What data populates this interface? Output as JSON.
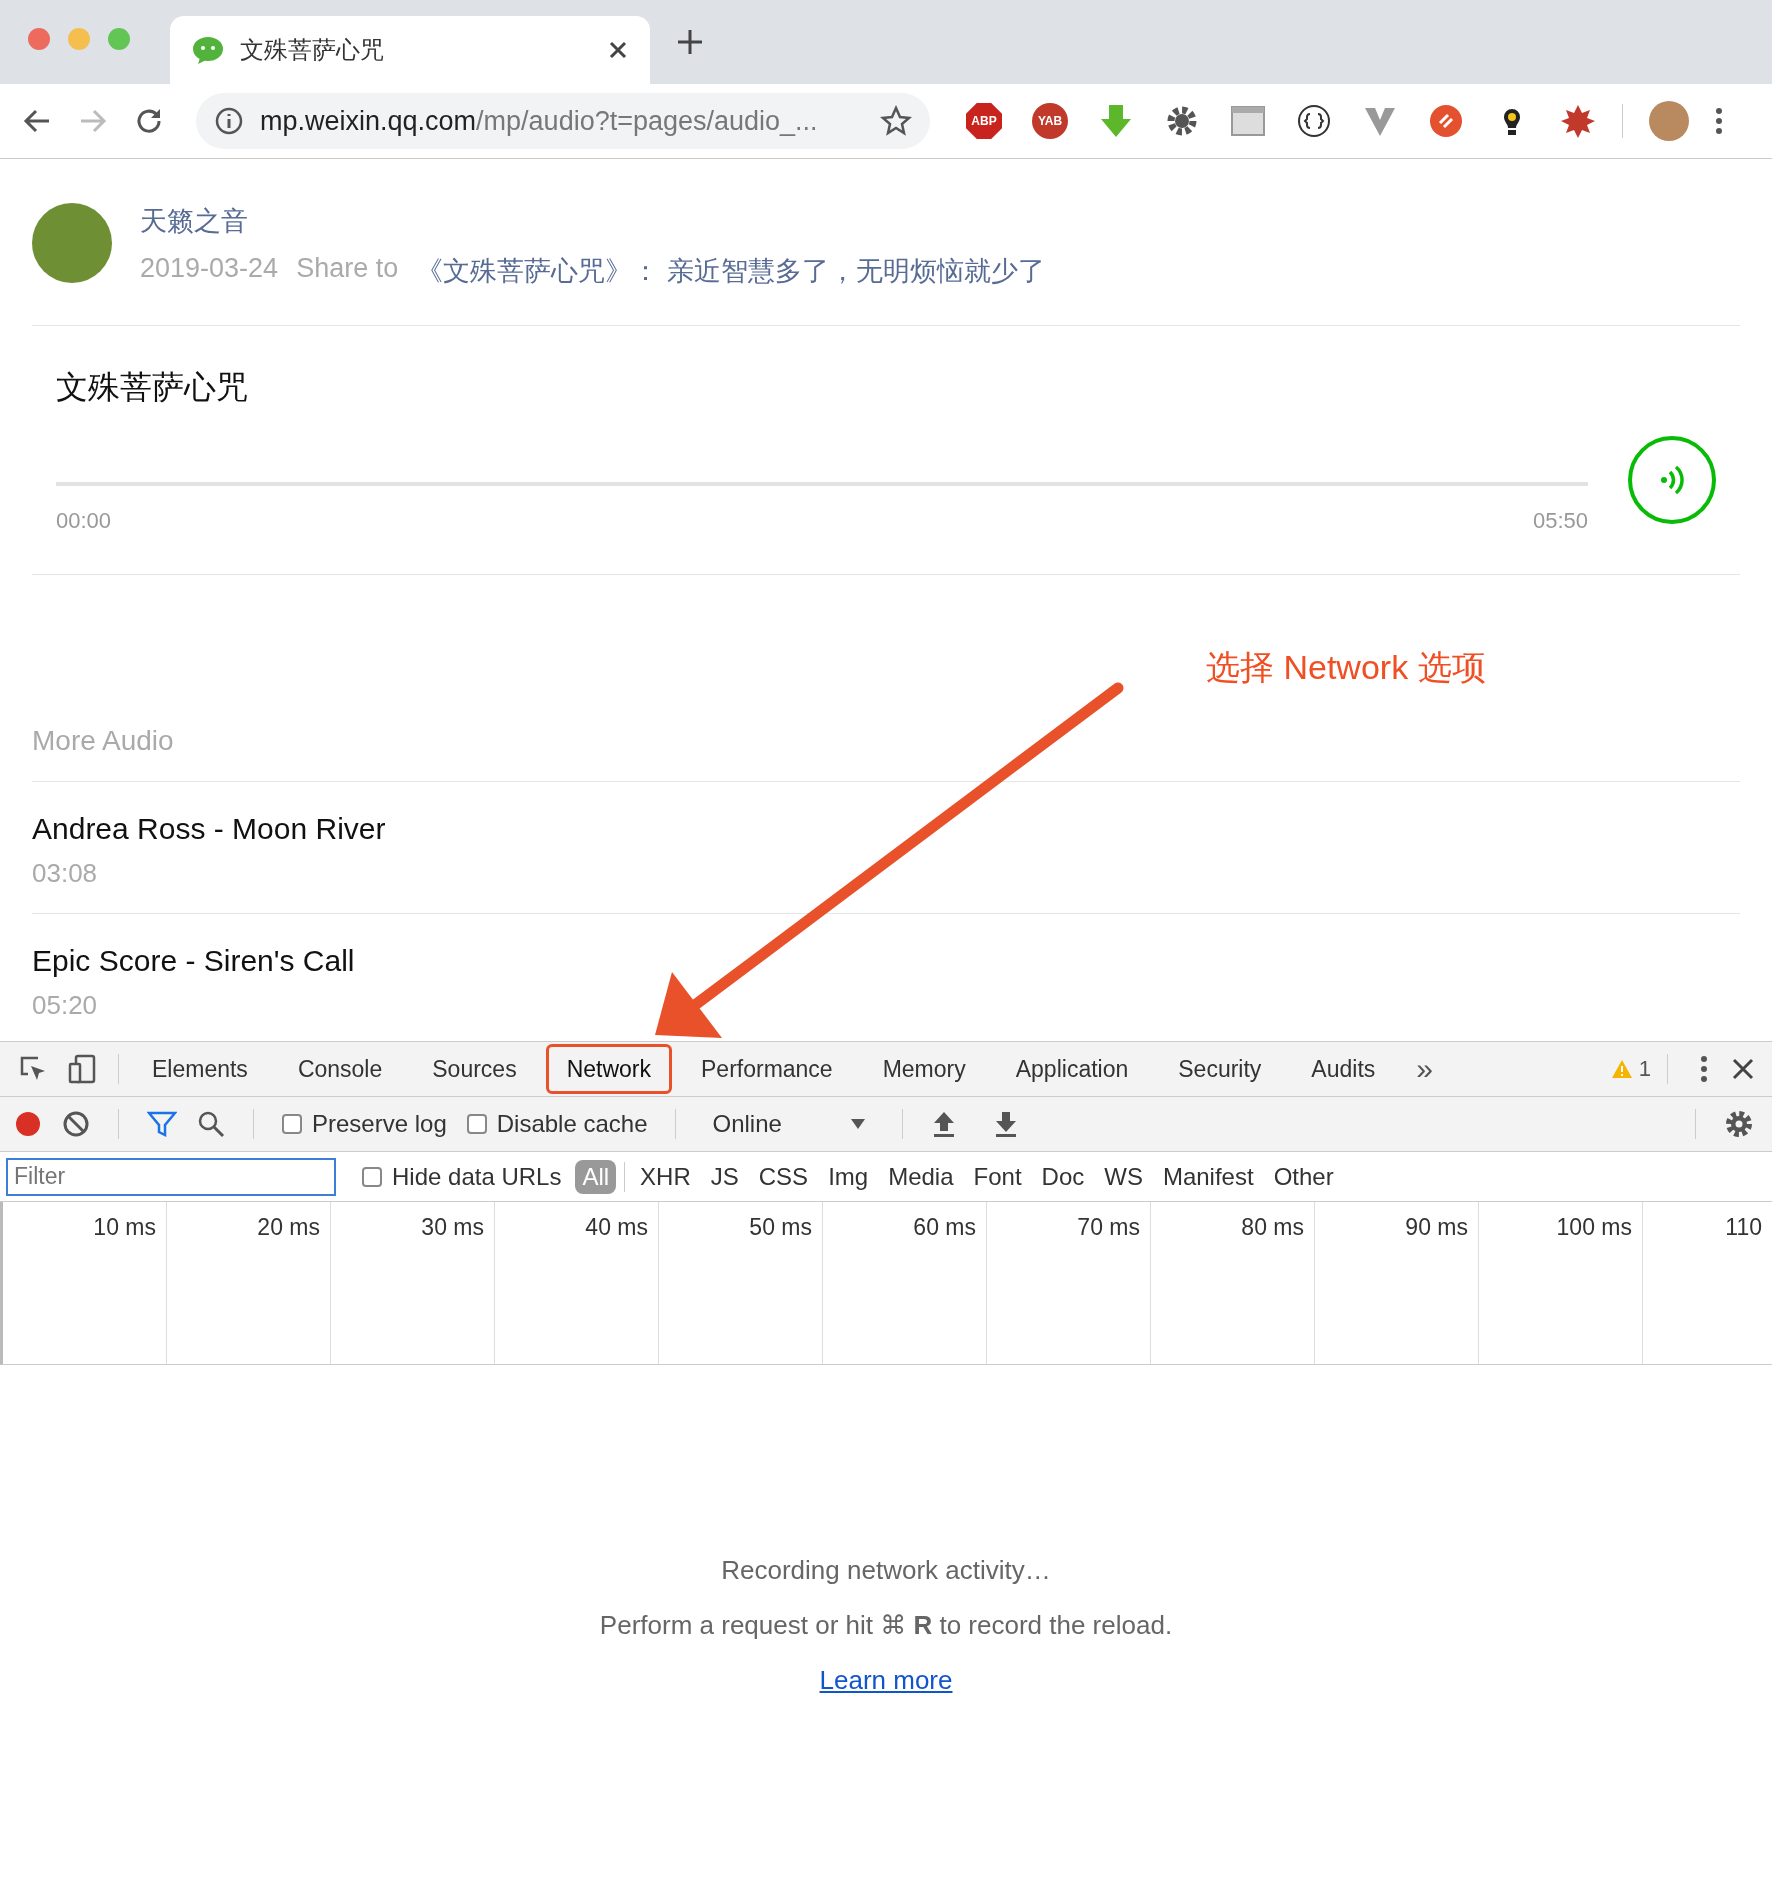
{
  "browser": {
    "tab": {
      "title": "文殊菩萨心咒"
    },
    "address": {
      "host": "mp.weixin.qq.com",
      "path": "/mp/audio?t=pages/audio_..."
    },
    "extensions": [
      {
        "kind": "abp",
        "label": "ABP"
      },
      {
        "kind": "yab",
        "label": "YAB"
      },
      {
        "kind": "download"
      },
      {
        "kind": "gear"
      },
      {
        "kind": "php"
      },
      {
        "kind": "braces"
      },
      {
        "kind": "vee"
      },
      {
        "kind": "link"
      },
      {
        "kind": "bulb"
      },
      {
        "kind": "burst"
      }
    ]
  },
  "post": {
    "author": "天籁之音",
    "date": "2019-03-24",
    "share_label": "Share to",
    "share_title": "《文殊菩萨心咒》： 亲近智慧多了，无明烦恼就少了"
  },
  "audio": {
    "title": "文殊菩萨心咒",
    "level": 0,
    "elapsed": "00:00",
    "duration": "05:50"
  },
  "annotation": {
    "text": "选择 Network 选项"
  },
  "more_audio": {
    "heading": "More Audio",
    "items": [
      {
        "title": "Andrea Ross - Moon River",
        "duration": "03:08"
      },
      {
        "title": "Epic Score - Siren's Call",
        "duration": "05:20"
      }
    ]
  },
  "devtools": {
    "tabs": [
      {
        "label": "Elements",
        "selected": false,
        "highlighted": false
      },
      {
        "label": "Console",
        "selected": false,
        "highlighted": false
      },
      {
        "label": "Sources",
        "selected": false,
        "highlighted": false
      },
      {
        "label": "Network",
        "selected": true,
        "highlighted": true
      },
      {
        "label": "Performance",
        "selected": false,
        "highlighted": false
      },
      {
        "label": "Memory",
        "selected": false,
        "highlighted": false
      },
      {
        "label": "Application",
        "selected": false,
        "highlighted": false
      },
      {
        "label": "Security",
        "selected": false,
        "highlighted": false
      },
      {
        "label": "Audits",
        "selected": false,
        "highlighted": false
      }
    ],
    "overflow": "»",
    "warnings": "1",
    "toolbar": {
      "recording": true,
      "filter_active": true,
      "preserve_log": {
        "label": "Preserve log",
        "checked": false
      },
      "disable_cache": {
        "label": "Disable cache",
        "checked": false
      },
      "throttling": "Online"
    },
    "filter": {
      "placeholder": "Filter",
      "hide_data_urls": {
        "label": "Hide data URLs",
        "checked": false
      },
      "types": [
        {
          "label": "All",
          "selected": true
        },
        {
          "label": "XHR",
          "selected": false
        },
        {
          "label": "JS",
          "selected": false
        },
        {
          "label": "CSS",
          "selected": false
        },
        {
          "label": "Img",
          "selected": false
        },
        {
          "label": "Media",
          "selected": false
        },
        {
          "label": "Font",
          "selected": false
        },
        {
          "label": "Doc",
          "selected": false
        },
        {
          "label": "WS",
          "selected": false
        },
        {
          "label": "Manifest",
          "selected": false
        },
        {
          "label": "Other",
          "selected": false
        }
      ]
    },
    "timeline_ticks": [
      "10 ms",
      "20 ms",
      "30 ms",
      "40 ms",
      "50 ms",
      "60 ms",
      "70 ms",
      "80 ms",
      "90 ms",
      "100 ms",
      "110"
    ],
    "empty": {
      "status": "Recording network activity…",
      "hint": "Perform a request or hit ⌘ **R** to record the reload.",
      "link": "Learn more"
    }
  }
}
